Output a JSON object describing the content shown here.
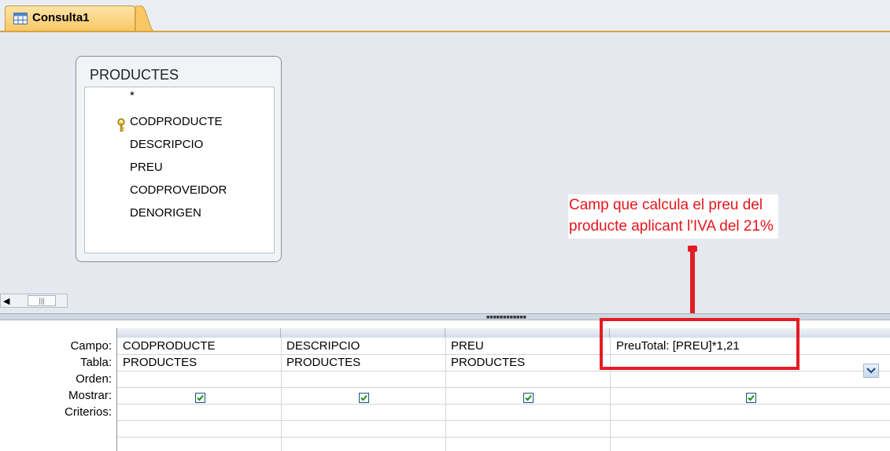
{
  "tab": {
    "label": "Consulta1"
  },
  "table": {
    "title": "PRODUCTES",
    "fields": [
      "*",
      "CODPRODUCTE",
      "DESCRIPCIO",
      "PREU",
      "CODPROVEIDOR",
      "DENORIGEN"
    ]
  },
  "annotation": {
    "line1": "Camp que calcula el preu del",
    "line2": "producte aplicant l'IVA del 21%"
  },
  "grid": {
    "row_labels": [
      "Campo:",
      "Tabla:",
      "Orden:",
      "Mostrar:",
      "Criterios:"
    ],
    "columns": [
      {
        "campo": "CODPRODUCTE",
        "tabla": "PRODUCTES",
        "mostrar": true
      },
      {
        "campo": "DESCRIPCIO",
        "tabla": "PRODUCTES",
        "mostrar": true
      },
      {
        "campo": "PREU",
        "tabla": "PRODUCTES",
        "mostrar": true
      },
      {
        "campo": "PreuTotal: [PREU]*1,21",
        "tabla": "",
        "mostrar": true
      }
    ]
  },
  "colors": {
    "tab": "#f8c864",
    "annotation": "#e8141a",
    "background": "#e5e9ef"
  }
}
